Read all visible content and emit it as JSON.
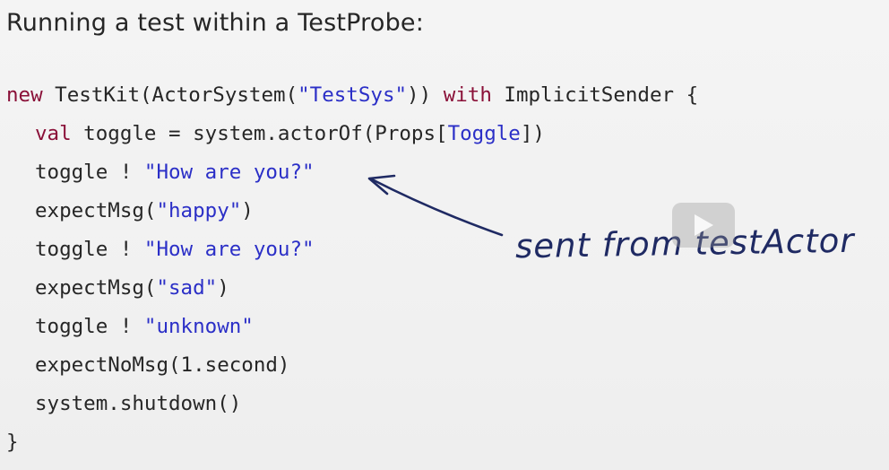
{
  "slide": {
    "title": "Running a test within a TestProbe:"
  },
  "code": {
    "line1": {
      "kw_new": "new",
      "part_a": " TestKit(ActorSystem(",
      "str_sys": "\"TestSys\"",
      "part_b": ")) ",
      "kw_with": "with",
      "part_c": " ImplicitSender {"
    },
    "line2": {
      "kw_val": "val",
      "part_a": " toggle = system.actorOf(Props[",
      "type": "Toggle",
      "part_b": "])"
    },
    "line3": {
      "part_a": "toggle ! ",
      "str": "\"How are you?\""
    },
    "line4": {
      "part_a": "expectMsg(",
      "str": "\"happy\"",
      "part_b": ")"
    },
    "line5": {
      "part_a": "toggle ! ",
      "str": "\"How are you?\""
    },
    "line6": {
      "part_a": "expectMsg(",
      "str": "\"sad\"",
      "part_b": ")"
    },
    "line7": {
      "part_a": "toggle ! ",
      "str": "\"unknown\""
    },
    "line8": {
      "text": "expectNoMsg(1.second)"
    },
    "line9": {
      "text": "system.shutdown()"
    },
    "line10": {
      "text": "}"
    }
  },
  "annotation": {
    "text": "sent from testActor"
  },
  "overlay": {
    "play_icon": "play-icon"
  },
  "colors": {
    "keyword": "#8a1038",
    "string": "#2b2fc7",
    "ink": "#1f2a63"
  }
}
